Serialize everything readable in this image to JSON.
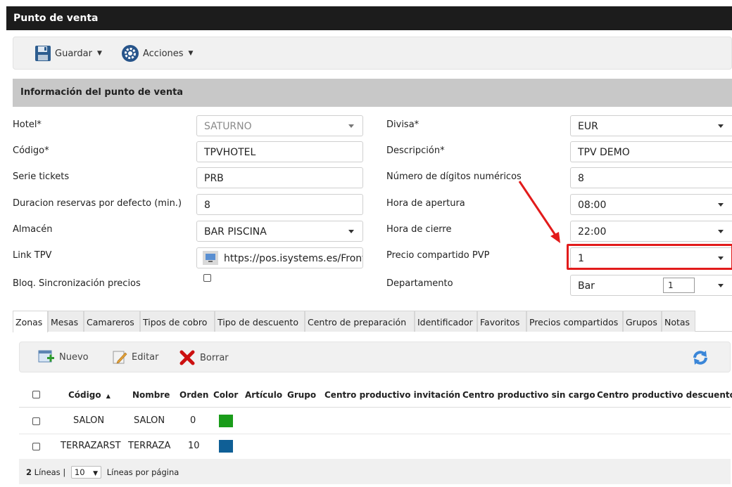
{
  "window": {
    "title": "Punto de venta"
  },
  "toolbar": {
    "save_label": "Guardar",
    "actions_label": "Acciones"
  },
  "section": {
    "title": "Información del punto de venta"
  },
  "form": {
    "hotel_label": "Hotel*",
    "hotel_value": "SATURNO",
    "codigo_label": "Código*",
    "codigo_value": "TPVHOTEL",
    "serie_label": "Serie tickets",
    "serie_value": "PRB",
    "duracion_label": "Duracion reservas por defecto (min.)",
    "duracion_value": "8",
    "almacen_label": "Almacén",
    "almacen_value": "BAR PISCINA",
    "link_label": "Link TPV",
    "link_value": "https://pos.isystems.es/Front",
    "bloq_label": "Bloq. Sincronización precios",
    "divisa_label": "Divisa*",
    "divisa_value": "EUR",
    "descripcion_label": "Descripción*",
    "descripcion_value": "TPV DEMO",
    "digitos_label": "Número de dígitos numéricos",
    "digitos_value": "8",
    "apertura_label": "Hora de apertura",
    "apertura_value": "08:00",
    "cierre_label": "Hora de cierre",
    "cierre_value": "22:00",
    "precio_label": "Precio compartido PVP",
    "precio_value": "1",
    "departamento_label": "Departamento",
    "departamento_value": "Bar",
    "departamento_num": "1"
  },
  "tabs": [
    "Zonas",
    "Mesas",
    "Camareros",
    "Tipos de cobro",
    "Tipo de descuento",
    "Centro de preparación",
    "Identificador",
    "Favoritos",
    "Precios compartidos",
    "Grupos",
    "Notas"
  ],
  "grid_toolbar": {
    "new_label": "Nuevo",
    "edit_label": "Editar",
    "delete_label": "Borrar"
  },
  "table": {
    "sort_indicator": "▲",
    "columns": [
      "Código",
      "Nombre",
      "Orden",
      "Color",
      "Artículo",
      "Grupo",
      "Centro productivo invitación",
      "Centro productivo sin cargo",
      "Centro productivo descuento"
    ],
    "rows": [
      {
        "codigo": "SALON",
        "nombre": "SALON",
        "orden": "0",
        "color": "#1a9c1a"
      },
      {
        "codigo": "TERRAZARST",
        "nombre": "TERRAZA",
        "orden": "10",
        "color": "#0f5f96"
      }
    ]
  },
  "footer": {
    "count": "2",
    "lines_label": "Líneas",
    "page_size": "10",
    "per_page_label": "Líneas por página"
  }
}
